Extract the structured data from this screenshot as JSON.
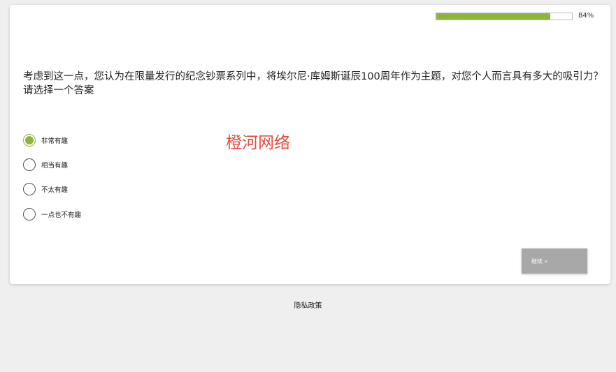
{
  "progress": {
    "percent_label": "84%",
    "value": 0.84
  },
  "question": {
    "text": "考虑到这一点，您认为在限量发行的纪念钞票系列中，将埃尔尼·库姆斯诞辰100周年作为主题，对您个人而言具有多大的吸引力？请选择一个答案"
  },
  "options": [
    {
      "label": "非常有趣",
      "selected": true
    },
    {
      "label": "相当有趣",
      "selected": false
    },
    {
      "label": "不太有趣",
      "selected": false
    },
    {
      "label": "一点也不有趣",
      "selected": false
    }
  ],
  "watermark": {
    "text": "橙河网络"
  },
  "next_button": {
    "label": "继续 »"
  },
  "footer": {
    "privacy_label": "隐私政策"
  },
  "colors": {
    "accent": "#8db53c",
    "watermark": "#e74c3c",
    "button": "#a8a8a8"
  }
}
